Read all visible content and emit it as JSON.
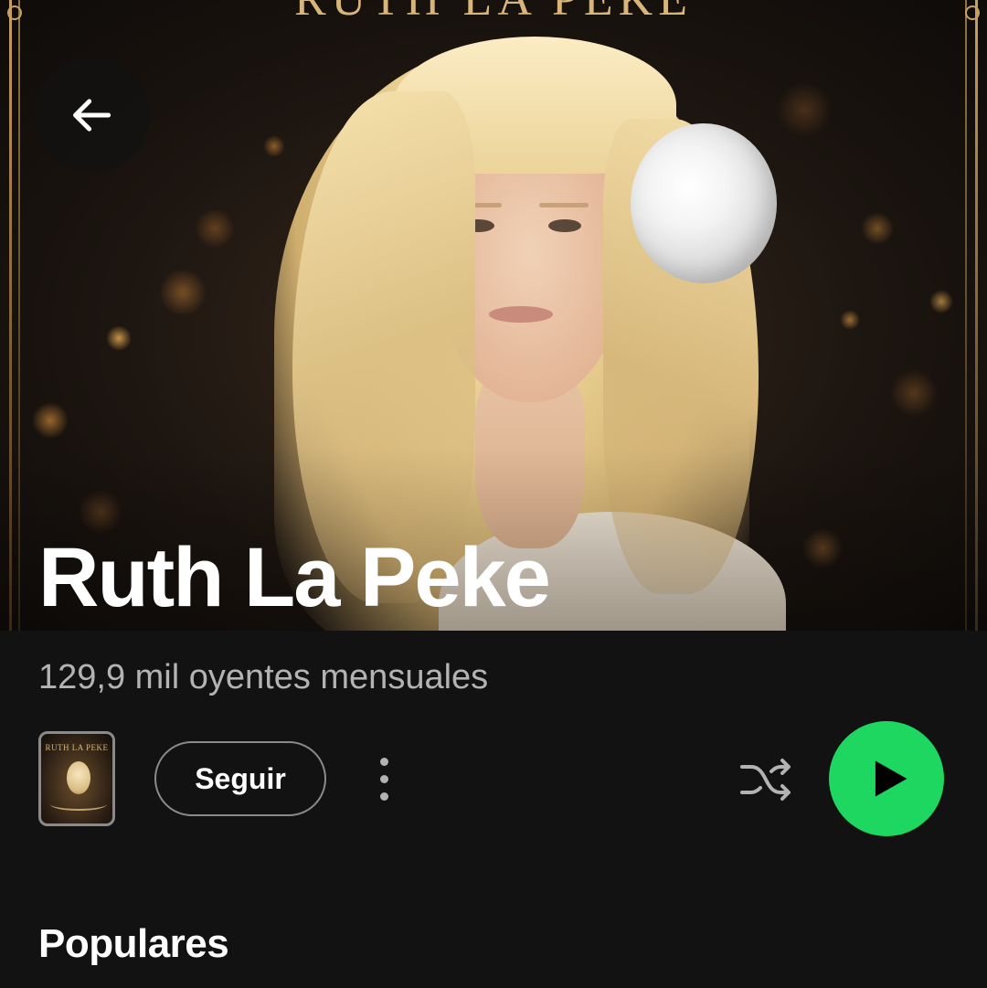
{
  "hero": {
    "cover_title": "RUTH LA PEKE",
    "artist_name": "Ruth La Peke"
  },
  "artist": {
    "monthly_listeners": "129,9 mil oyentes mensuales"
  },
  "thumbnail": {
    "title": "RUTH LA PEKE"
  },
  "actions": {
    "follow_label": "Seguir"
  },
  "sections": {
    "popular_title": "Populares"
  },
  "icons": {
    "back": "arrow-left-icon",
    "more": "more-vertical-icon",
    "shuffle": "shuffle-icon",
    "play": "play-icon"
  },
  "colors": {
    "background": "#121212",
    "accent_green": "#1ed760",
    "secondary_text": "#b3b3b3",
    "frame_gold": "#c9a063"
  }
}
